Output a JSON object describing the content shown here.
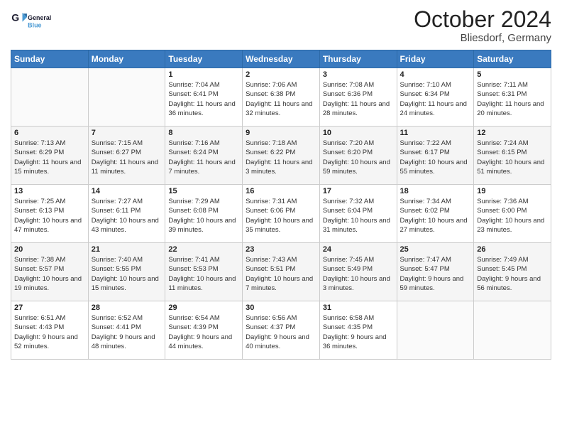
{
  "header": {
    "logo_general": "General",
    "logo_blue": "Blue",
    "month": "October 2024",
    "location": "Bliesdorf, Germany"
  },
  "days_of_week": [
    "Sunday",
    "Monday",
    "Tuesday",
    "Wednesday",
    "Thursday",
    "Friday",
    "Saturday"
  ],
  "weeks": [
    [
      {
        "day": "",
        "info": ""
      },
      {
        "day": "",
        "info": ""
      },
      {
        "day": "1",
        "info": "Sunrise: 7:04 AM\nSunset: 6:41 PM\nDaylight: 11 hours and 36 minutes."
      },
      {
        "day": "2",
        "info": "Sunrise: 7:06 AM\nSunset: 6:38 PM\nDaylight: 11 hours and 32 minutes."
      },
      {
        "day": "3",
        "info": "Sunrise: 7:08 AM\nSunset: 6:36 PM\nDaylight: 11 hours and 28 minutes."
      },
      {
        "day": "4",
        "info": "Sunrise: 7:10 AM\nSunset: 6:34 PM\nDaylight: 11 hours and 24 minutes."
      },
      {
        "day": "5",
        "info": "Sunrise: 7:11 AM\nSunset: 6:31 PM\nDaylight: 11 hours and 20 minutes."
      }
    ],
    [
      {
        "day": "6",
        "info": "Sunrise: 7:13 AM\nSunset: 6:29 PM\nDaylight: 11 hours and 15 minutes."
      },
      {
        "day": "7",
        "info": "Sunrise: 7:15 AM\nSunset: 6:27 PM\nDaylight: 11 hours and 11 minutes."
      },
      {
        "day": "8",
        "info": "Sunrise: 7:16 AM\nSunset: 6:24 PM\nDaylight: 11 hours and 7 minutes."
      },
      {
        "day": "9",
        "info": "Sunrise: 7:18 AM\nSunset: 6:22 PM\nDaylight: 11 hours and 3 minutes."
      },
      {
        "day": "10",
        "info": "Sunrise: 7:20 AM\nSunset: 6:20 PM\nDaylight: 10 hours and 59 minutes."
      },
      {
        "day": "11",
        "info": "Sunrise: 7:22 AM\nSunset: 6:17 PM\nDaylight: 10 hours and 55 minutes."
      },
      {
        "day": "12",
        "info": "Sunrise: 7:24 AM\nSunset: 6:15 PM\nDaylight: 10 hours and 51 minutes."
      }
    ],
    [
      {
        "day": "13",
        "info": "Sunrise: 7:25 AM\nSunset: 6:13 PM\nDaylight: 10 hours and 47 minutes."
      },
      {
        "day": "14",
        "info": "Sunrise: 7:27 AM\nSunset: 6:11 PM\nDaylight: 10 hours and 43 minutes."
      },
      {
        "day": "15",
        "info": "Sunrise: 7:29 AM\nSunset: 6:08 PM\nDaylight: 10 hours and 39 minutes."
      },
      {
        "day": "16",
        "info": "Sunrise: 7:31 AM\nSunset: 6:06 PM\nDaylight: 10 hours and 35 minutes."
      },
      {
        "day": "17",
        "info": "Sunrise: 7:32 AM\nSunset: 6:04 PM\nDaylight: 10 hours and 31 minutes."
      },
      {
        "day": "18",
        "info": "Sunrise: 7:34 AM\nSunset: 6:02 PM\nDaylight: 10 hours and 27 minutes."
      },
      {
        "day": "19",
        "info": "Sunrise: 7:36 AM\nSunset: 6:00 PM\nDaylight: 10 hours and 23 minutes."
      }
    ],
    [
      {
        "day": "20",
        "info": "Sunrise: 7:38 AM\nSunset: 5:57 PM\nDaylight: 10 hours and 19 minutes."
      },
      {
        "day": "21",
        "info": "Sunrise: 7:40 AM\nSunset: 5:55 PM\nDaylight: 10 hours and 15 minutes."
      },
      {
        "day": "22",
        "info": "Sunrise: 7:41 AM\nSunset: 5:53 PM\nDaylight: 10 hours and 11 minutes."
      },
      {
        "day": "23",
        "info": "Sunrise: 7:43 AM\nSunset: 5:51 PM\nDaylight: 10 hours and 7 minutes."
      },
      {
        "day": "24",
        "info": "Sunrise: 7:45 AM\nSunset: 5:49 PM\nDaylight: 10 hours and 3 minutes."
      },
      {
        "day": "25",
        "info": "Sunrise: 7:47 AM\nSunset: 5:47 PM\nDaylight: 9 hours and 59 minutes."
      },
      {
        "day": "26",
        "info": "Sunrise: 7:49 AM\nSunset: 5:45 PM\nDaylight: 9 hours and 56 minutes."
      }
    ],
    [
      {
        "day": "27",
        "info": "Sunrise: 6:51 AM\nSunset: 4:43 PM\nDaylight: 9 hours and 52 minutes."
      },
      {
        "day": "28",
        "info": "Sunrise: 6:52 AM\nSunset: 4:41 PM\nDaylight: 9 hours and 48 minutes."
      },
      {
        "day": "29",
        "info": "Sunrise: 6:54 AM\nSunset: 4:39 PM\nDaylight: 9 hours and 44 minutes."
      },
      {
        "day": "30",
        "info": "Sunrise: 6:56 AM\nSunset: 4:37 PM\nDaylight: 9 hours and 40 minutes."
      },
      {
        "day": "31",
        "info": "Sunrise: 6:58 AM\nSunset: 4:35 PM\nDaylight: 9 hours and 36 minutes."
      },
      {
        "day": "",
        "info": ""
      },
      {
        "day": "",
        "info": ""
      }
    ]
  ]
}
